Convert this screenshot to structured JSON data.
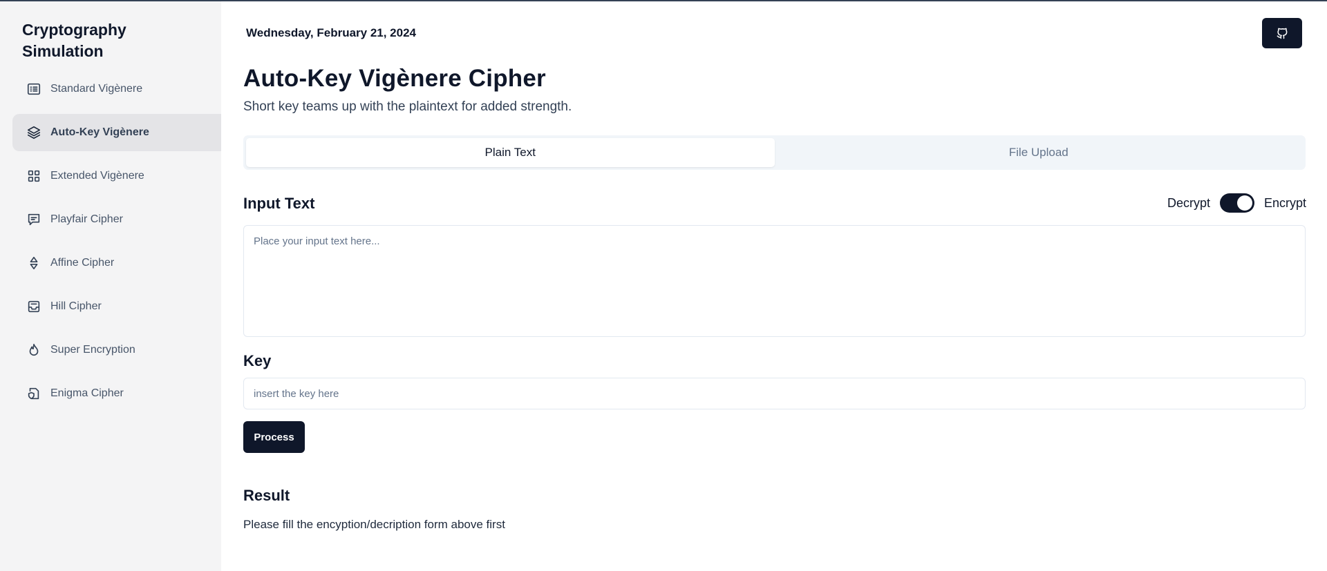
{
  "sidebar": {
    "brand": "Cryptography Simulation",
    "items": [
      {
        "label": "Standard Vigènere",
        "icon": "list-icon",
        "active": false
      },
      {
        "label": "Auto-Key Vigènere",
        "icon": "layers-icon",
        "active": true
      },
      {
        "label": "Extended Vigènere",
        "icon": "grid-icon",
        "active": false
      },
      {
        "label": "Playfair Cipher",
        "icon": "message-square-icon",
        "active": false
      },
      {
        "label": "Affine Cipher",
        "icon": "diamond-arrows-icon",
        "active": false
      },
      {
        "label": "Hill Cipher",
        "icon": "inbox-icon",
        "active": false
      },
      {
        "label": "Super Encryption",
        "icon": "flame-icon",
        "active": false
      },
      {
        "label": "Enigma Cipher",
        "icon": "shield-file-icon",
        "active": false
      }
    ]
  },
  "header": {
    "date": "Wednesday, February 21, 2024",
    "github_icon": "github-icon"
  },
  "main": {
    "title": "Auto-Key Vigènere Cipher",
    "subtitle": "Short key teams up with the plaintext for added strength.",
    "tabs": [
      {
        "label": "Plain Text",
        "active": true
      },
      {
        "label": "File Upload",
        "active": false
      }
    ],
    "input_title": "Input Text",
    "mode": {
      "left_label": "Decrypt",
      "right_label": "Encrypt",
      "selected": "Encrypt"
    },
    "input_placeholder": "Place your input text here...",
    "input_value": "",
    "key_title": "Key",
    "key_placeholder": "insert the key here",
    "key_value": "",
    "process_label": "Process",
    "result_title": "Result",
    "result_text": "Please fill the encyption/decription form above first"
  },
  "colors": {
    "primary": "#0f172a",
    "sidebar_bg": "#f4f4f5",
    "sidebar_active": "#e4e4e7",
    "tabs_bg": "#f1f5f9"
  }
}
